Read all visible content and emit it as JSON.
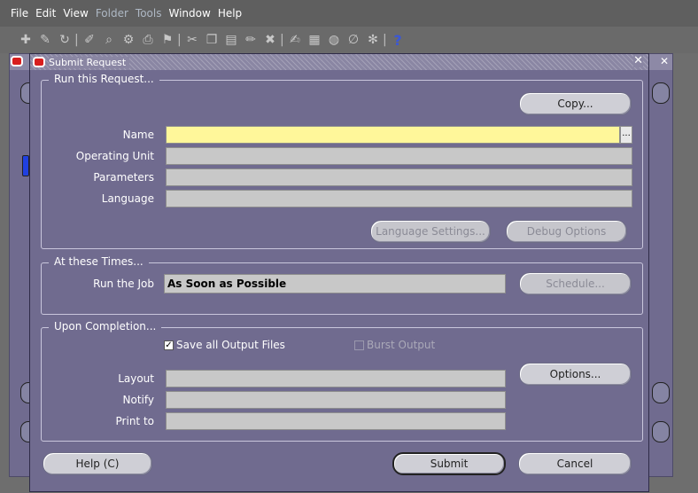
{
  "menu": {
    "items": [
      "File",
      "Edit",
      "View",
      "Folder",
      "Tools",
      "Window",
      "Help"
    ]
  },
  "toolbar": {
    "icons": [
      "new-icon",
      "pen-icon",
      "refresh-icon",
      "edit-icon",
      "zoom-icon",
      "gear-icon",
      "print-icon",
      "flag-icon",
      "cut-icon",
      "copy-icon",
      "paste-icon",
      "clear-icon",
      "delete-icon",
      "attach-icon",
      "folder-icon",
      "world-icon",
      "link-icon",
      "tool-icon",
      "help-icon"
    ],
    "help_glyph": "?"
  },
  "dialog": {
    "title": "Submit Request",
    "close_glyph": "✕",
    "run_request": {
      "legend": "Run this Request...",
      "copy_button": "Copy...",
      "name_label": "Name",
      "name_value": "",
      "lov_glyph": "...",
      "operating_unit_label": "Operating Unit",
      "operating_unit_value": "",
      "parameters_label": "Parameters",
      "parameters_value": "",
      "language_label": "Language",
      "language_value": "",
      "language_settings_button": "Language Settings...",
      "debug_options_button": "Debug Options"
    },
    "times": {
      "legend": "At these Times...",
      "run_job_label": "Run the Job",
      "run_job_value": "As Soon as Possible",
      "schedule_button": "Schedule..."
    },
    "completion": {
      "legend": "Upon Completion...",
      "save_output_label": "Save all Output Files",
      "save_output_checked": true,
      "burst_output_label": "Burst Output",
      "burst_output_checked": false,
      "layout_label": "Layout",
      "layout_value": "",
      "notify_label": "Notify",
      "notify_value": "",
      "print_to_label": "Print to",
      "print_to_value": "",
      "options_button": "Options..."
    },
    "footer": {
      "help_button": "Help (C)",
      "submit_button": "Submit",
      "cancel_button": "Cancel"
    }
  },
  "colors": {
    "dialog_bg": "#706b8f",
    "required_field": "#fff79a",
    "field_bg": "#c8c8c8"
  }
}
